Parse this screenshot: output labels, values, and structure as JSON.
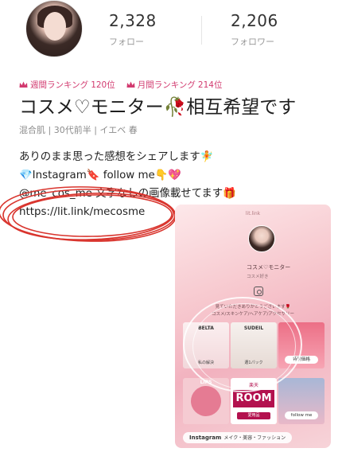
{
  "profile": {
    "followers": {
      "count": "2,328",
      "label": "フォロー"
    },
    "following": {
      "count": "2,206",
      "label": "フォロワー"
    },
    "rankings": [
      {
        "label": "週間ランキング",
        "value": "120位"
      },
      {
        "label": "月間ランキング",
        "value": "214位"
      }
    ],
    "name": "コスメ♡モニター🥀相互希望です",
    "tags": "混合肌 | 30代前半 | イエベ 春",
    "bio": [
      "ありのまま思った感想をシェアします🧚",
      "💎Instagram🔖 follow me👇💖",
      "@me_cos_me 文字なしの画像載せてます🎁",
      "https://lit.link/mecosme"
    ]
  },
  "linkcard": {
    "brand": "lit.link",
    "name": "コスメ♡モニター",
    "subtitle": "コスメ好き",
    "text1": "見ていただきありがとうございます🌹",
    "text2": "コスメ/スキンケア/ヘアケア/アクセサリー",
    "tiles": [
      {
        "head": "BELTA",
        "label": "私の解決"
      },
      {
        "head": "SUDEIL",
        "label": "選1パック"
      },
      {
        "head": "",
        "label": "特別価格"
      },
      {
        "head": "LIPS",
        "label": ""
      },
      {
        "head": "楽天",
        "room": "ROOM",
        "label": "愛用品"
      },
      {
        "head": "",
        "label": "follow me"
      }
    ],
    "instagram_pill": {
      "bold": "Instagram",
      "text": "メイク・美容・ファッション"
    }
  },
  "colors": {
    "rank_accent": "#d23a6f",
    "scribble": "#d9352e",
    "room_brand": "#b3114e"
  }
}
